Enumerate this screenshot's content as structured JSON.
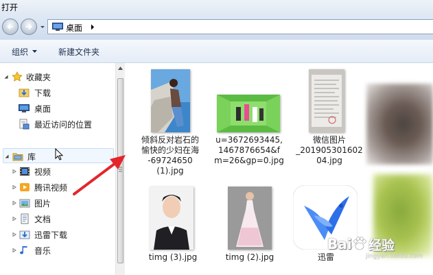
{
  "window": {
    "title": "打开"
  },
  "address": {
    "location": "桌面"
  },
  "toolbar": {
    "organize_label": "组织",
    "new_folder_label": "新建文件夹"
  },
  "nav": {
    "favorites": {
      "label": "收藏夹",
      "items": [
        {
          "label": "下载",
          "icon": "download-folder-icon"
        },
        {
          "label": "桌面",
          "icon": "desktop-icon"
        },
        {
          "label": "最近访问的位置",
          "icon": "recent-places-icon"
        }
      ]
    },
    "libraries": {
      "label": "库",
      "items": [
        {
          "label": "视频",
          "icon": "video-library-icon"
        },
        {
          "label": "腾讯视频",
          "icon": "tencent-video-icon"
        },
        {
          "label": "图片",
          "icon": "pictures-library-icon"
        },
        {
          "label": "文档",
          "icon": "documents-library-icon"
        },
        {
          "label": "迅雷下载",
          "icon": "xunlei-download-icon"
        },
        {
          "label": "音乐",
          "icon": "music-library-icon"
        }
      ]
    }
  },
  "files": [
    {
      "name_lines": [
        "倾斜反对岩石的",
        "愉快的少妇在海",
        "-69724650",
        "(1).jpg"
      ]
    },
    {
      "name_lines": [
        "u=3672693445,",
        "1467876654&f",
        "m=26&gp=0.jpg"
      ]
    },
    {
      "name_lines": [
        "微信图片",
        "_201905301602",
        "04.jpg"
      ]
    },
    {
      "name_lines": [
        "timg (3).jpg"
      ]
    },
    {
      "name_lines": [
        "timg (2).jpg"
      ]
    },
    {
      "name_lines": [
        "迅雷"
      ]
    }
  ],
  "watermark": {
    "brand": "Bai",
    "text": "经验",
    "sub": "jingyan.baidu.com"
  },
  "colors": {
    "annotation_arrow": "#e3262c",
    "selection": "#c7ddf5"
  }
}
